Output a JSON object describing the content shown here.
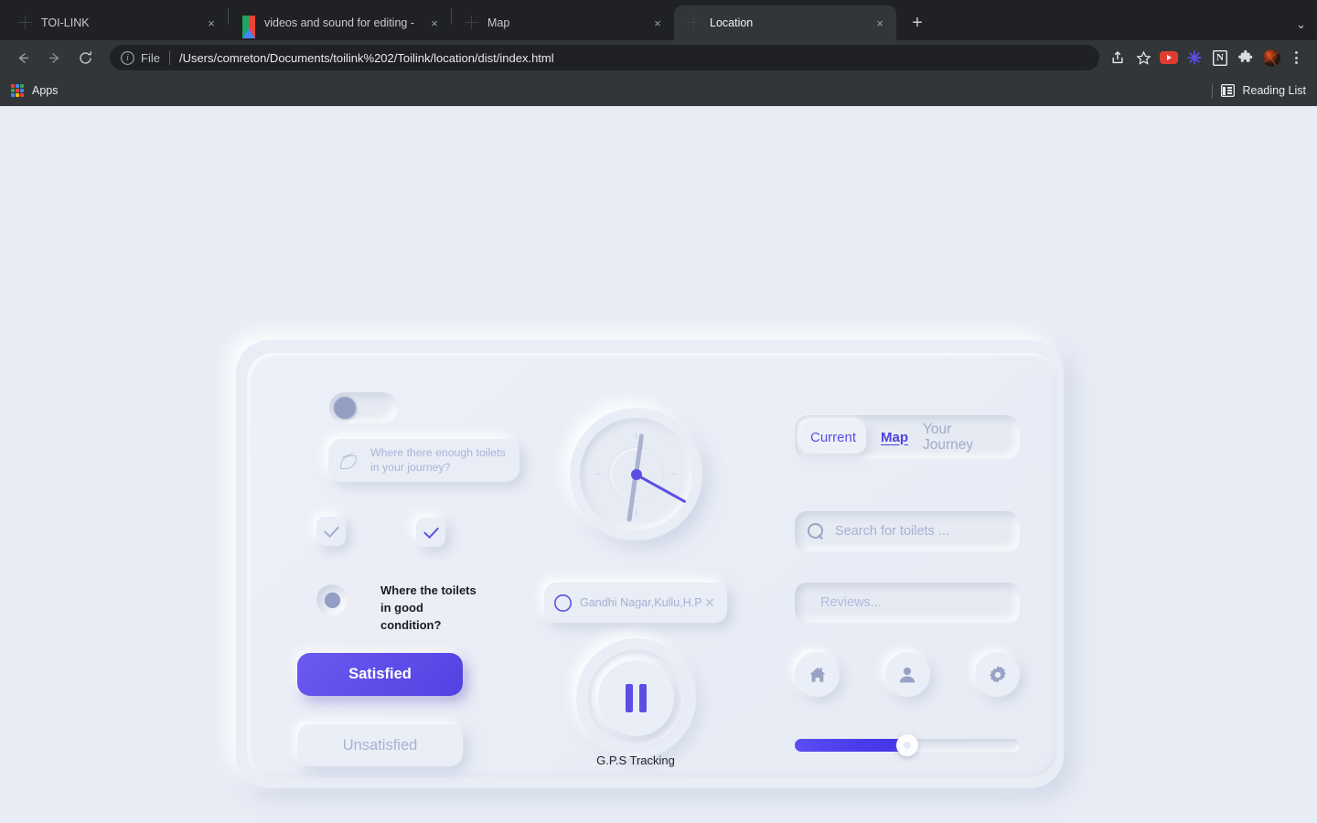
{
  "browser": {
    "tabs": [
      {
        "title": "TOI-LINK",
        "favicon": "globe-icon",
        "active": false,
        "close_label": "×"
      },
      {
        "title": "videos and sound for editing -",
        "favicon": "google-drive-icon",
        "active": false,
        "close_label": "×"
      },
      {
        "title": "Map",
        "favicon": "globe-icon",
        "active": false,
        "close_label": "×"
      },
      {
        "title": "Location",
        "favicon": "globe-icon",
        "active": true,
        "close_label": "×"
      }
    ],
    "new_tab_label": "+",
    "tabstrip_menu_label": "⌄",
    "nav": {
      "back_label": "back-arrow-icon",
      "forward_label": "forward-arrow-icon",
      "reload_label": "reload-icon"
    },
    "omnibox": {
      "info_label": "i",
      "scheme": "File",
      "url": "/Users/comreton/Documents/toilink%202/Toilink/location/dist/index.html"
    },
    "toolbar_icons": [
      "share-icon",
      "bookmark-star-icon",
      "youtube-extension-icon",
      "asterisk-extension-icon",
      "notion-extension-icon",
      "puzzle-extensions-icon",
      "profile-avatar-icon",
      "kebab-menu-icon"
    ],
    "notion_glyph": "N",
    "puzzle_glyph": "❖",
    "bookmarks": {
      "apps_label": "Apps",
      "reading_list_label": "Reading List"
    }
  },
  "app": {
    "left": {
      "toggle": {
        "name": "availability-toggle",
        "state": "off"
      },
      "question_pill": {
        "icon": "leaf-icon",
        "text": "Where there enough toilets\nin your journey?"
      },
      "checkbox_one": {
        "checked": true,
        "color": "#a4aecd"
      },
      "checkbox_two": {
        "checked": true,
        "color": "#5c4ee5"
      },
      "radio": {
        "selected": true
      },
      "question_dark": "Where the toilets\nin good\ncondition?",
      "satisfied_label": "Satisfied",
      "unsatisfied_label": "Unsatisfied",
      "accent": "#5c4ee5"
    },
    "center": {
      "clock": {
        "hour_deg": 8,
        "minute_deg": 188,
        "second_deg": 119,
        "ticks": [
          "12",
          "3",
          "6",
          "9"
        ],
        "second_hand_color": "#5c4ee5"
      },
      "location_chip": {
        "icon": "compass-icon",
        "value": "Gandhi Nagar,Kullu,H.P",
        "clear_label": "✕"
      },
      "gps": {
        "button_icon": "pause-icon",
        "label": "G.P.S Tracking"
      }
    },
    "right": {
      "tabs": [
        {
          "label": "Current",
          "style": "pill-active"
        },
        {
          "label": "Map",
          "style": "underlined-link"
        },
        {
          "label": "Your\nJourney",
          "style": "muted"
        }
      ],
      "search": {
        "icon": "search-icon",
        "placeholder": "Search for toilets ..."
      },
      "reviews": {
        "placeholder": "Reviews..."
      },
      "icon_buttons": [
        {
          "name": "home-button",
          "icon": "home-icon"
        },
        {
          "name": "profile-button",
          "icon": "user-icon"
        },
        {
          "name": "settings-button",
          "icon": "gear-icon"
        }
      ],
      "slider": {
        "value": 50,
        "min": 0,
        "max": 100
      }
    }
  }
}
